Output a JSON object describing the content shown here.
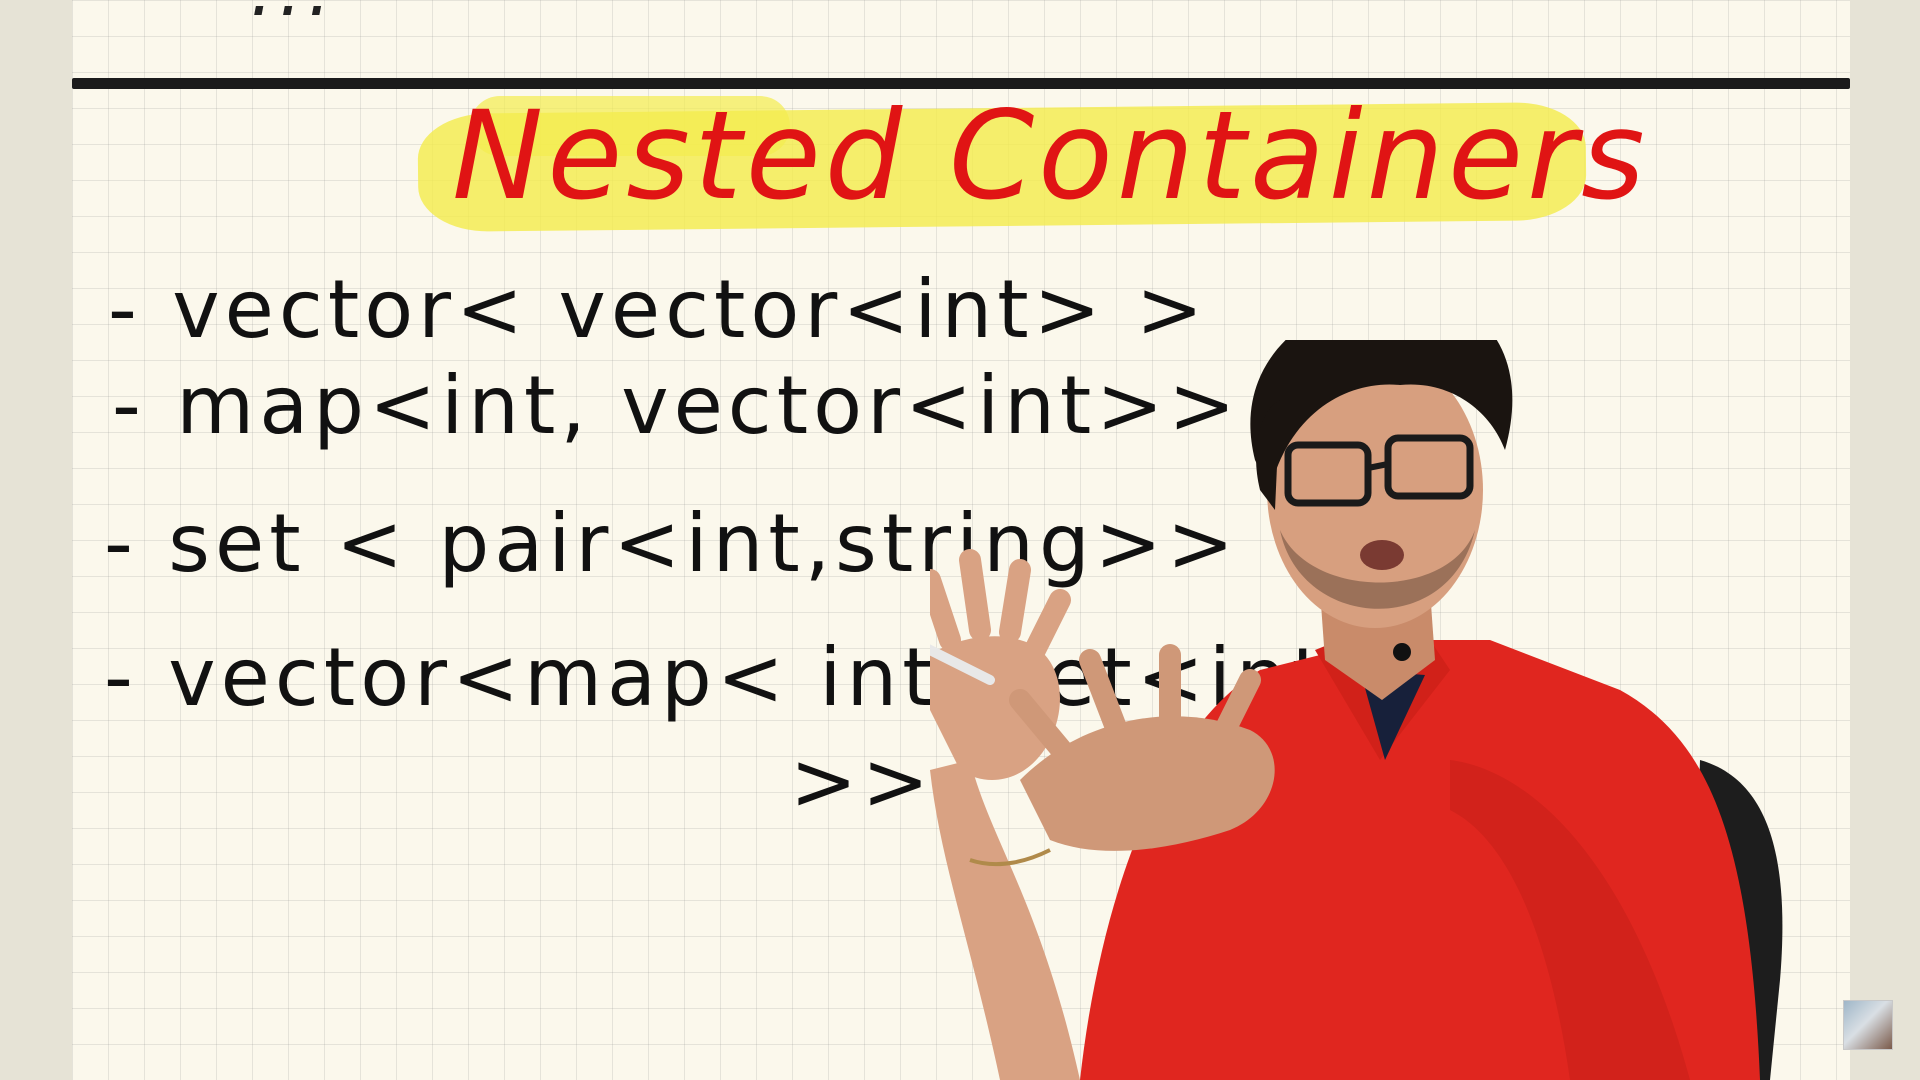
{
  "board": {
    "previous_heading": "...",
    "title": "Nested Containers",
    "lines": [
      "- vector< vector<int> >",
      "- map<int, vector<int>>",
      "- set < pair<int,string>>",
      "- vector<map< int, set<int>",
      ">>"
    ],
    "colors": {
      "paper": "#fbf8ec",
      "grid": "#c8c8c8",
      "ink": "#111111",
      "title_ink": "#e01414",
      "highlighter": "#f3ec4e",
      "shirt": "#e0261f"
    }
  },
  "presenter": {
    "shirt": "red polo",
    "accessory": "eyeglasses"
  },
  "corner_thumbnail": {
    "icon": "channel-thumbnail-icon"
  }
}
